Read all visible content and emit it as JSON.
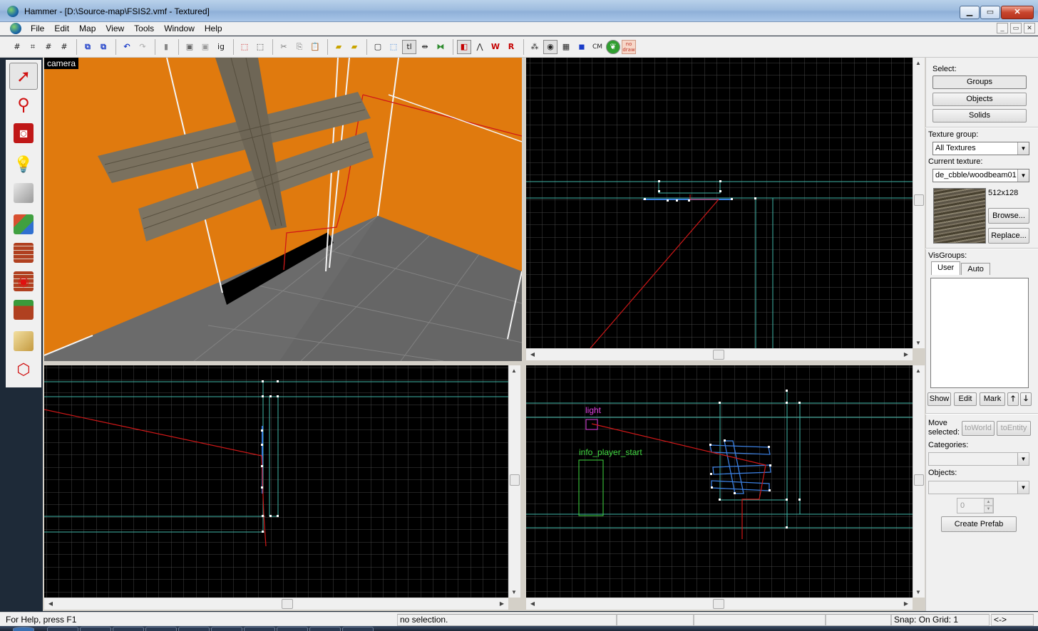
{
  "window": {
    "title": "Hammer - [D:\\Source-map\\FSIS2.vmf - Textured]",
    "minimize": "▁",
    "maximize": "▭",
    "close": "✕"
  },
  "menu": [
    "File",
    "Edit",
    "Map",
    "View",
    "Tools",
    "Window",
    "Help"
  ],
  "mdi_buttons": [
    "_",
    "▭",
    "✕"
  ],
  "toolbar": {
    "ignore_groups_label": "ig",
    "texture_lock_label": "tl",
    "cordon_label": "CM",
    "nodraw_label": "no draw"
  },
  "viewports": {
    "camera_label": "camera",
    "top_right_label": "",
    "entity_labels": {
      "light": "light",
      "info_player_start": "info_player_start"
    }
  },
  "panel": {
    "select_label": "Select:",
    "select_buttons": [
      "Groups",
      "Objects",
      "Solids"
    ],
    "texture_group_label": "Texture group:",
    "texture_group_value": "All Textures",
    "current_texture_label": "Current texture:",
    "current_texture_value": "de_cbble/woodbeam01",
    "texture_size": "512x128",
    "browse_button": "Browse...",
    "replace_button": "Replace...",
    "visgroups_label": "VisGroups:",
    "visgroup_tabs": [
      "User",
      "Auto"
    ],
    "visgroup_buttons": [
      "Show",
      "Edit",
      "Mark"
    ],
    "move_selected_label": "Move selected:",
    "to_world_button": "toWorld",
    "to_entity_button": "toEntity",
    "categories_label": "Categories:",
    "objects_label": "Objects:",
    "spin_value": "0",
    "create_prefab_button": "Create Prefab"
  },
  "status": {
    "help": "For Help, press F1",
    "selection": "no selection.",
    "snap": "Snap: On Grid: 1",
    "arrows": "<->"
  },
  "colors": {
    "camera_bg": "#e07a0e",
    "grid_line": "#3f3f3f",
    "cyan_line": "#3fb6a8",
    "red_line": "#d01818",
    "light_entity": "#e040e0",
    "player_entity": "#40d840"
  }
}
